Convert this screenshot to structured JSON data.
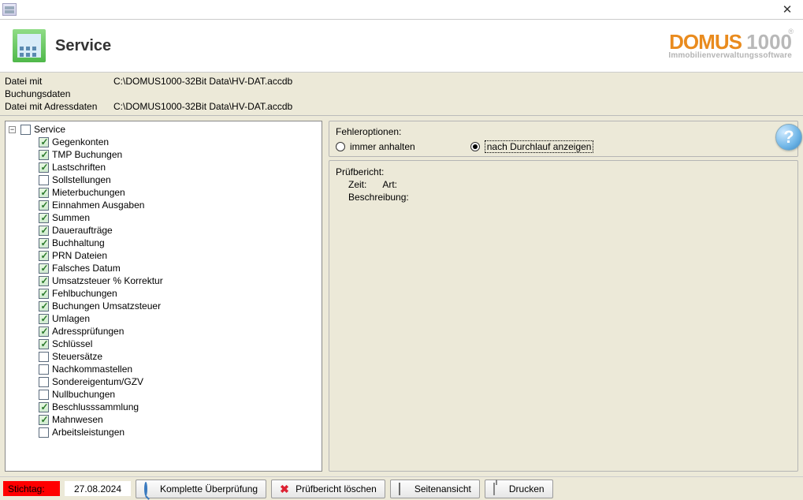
{
  "header": {
    "title": "Service"
  },
  "brand": {
    "main": "DOMUS ",
    "numbers": "1000",
    "reg": "®",
    "sub": "Immobilienverwaltungssoftware"
  },
  "paths": {
    "label_booking": "Datei mit Buchungsdaten",
    "value_booking": "C:\\DOMUS1000-32Bit Data\\HV-DAT.accdb",
    "label_address": "Datei mit Adressdaten",
    "value_address": "C:\\DOMUS1000-32Bit Data\\HV-DAT.accdb"
  },
  "tree": {
    "root": {
      "label": "Service",
      "checked": false
    },
    "items": [
      {
        "label": "Gegenkonten",
        "checked": true
      },
      {
        "label": "TMP Buchungen",
        "checked": true
      },
      {
        "label": "Lastschriften",
        "checked": true
      },
      {
        "label": "Sollstellungen",
        "checked": false
      },
      {
        "label": "Mieterbuchungen",
        "checked": true
      },
      {
        "label": "Einnahmen Ausgaben",
        "checked": true
      },
      {
        "label": "Summen",
        "checked": true
      },
      {
        "label": "Daueraufträge",
        "checked": true
      },
      {
        "label": "Buchhaltung",
        "checked": true
      },
      {
        "label": "PRN Dateien",
        "checked": true
      },
      {
        "label": "Falsches Datum",
        "checked": true
      },
      {
        "label": "Umsatzsteuer % Korrektur",
        "checked": true
      },
      {
        "label": "Fehlbuchungen",
        "checked": true
      },
      {
        "label": "Buchungen Umsatzsteuer",
        "checked": true
      },
      {
        "label": "Umlagen",
        "checked": true
      },
      {
        "label": "Adressprüfungen",
        "checked": true
      },
      {
        "label": "Schlüssel",
        "checked": true
      },
      {
        "label": "Steuersätze",
        "checked": false
      },
      {
        "label": "Nachkommastellen",
        "checked": false
      },
      {
        "label": "Sondereigentum/GZV",
        "checked": false
      },
      {
        "label": "Nullbuchungen",
        "checked": false
      },
      {
        "label": "Beschlusssammlung",
        "checked": true
      },
      {
        "label": "Mahnwesen",
        "checked": true
      },
      {
        "label": "Arbeitsleistungen",
        "checked": false
      }
    ]
  },
  "error_opts": {
    "legend": "Fehleroptionen:",
    "opt1": "immer anhalten",
    "opt2": "nach Durchlauf anzeigen",
    "selected": 2
  },
  "help_icon_text": "?",
  "report": {
    "legend": "Prüfbericht:",
    "time_lbl": "Zeit:",
    "time_val": "",
    "art_lbl": "Art:",
    "art_val": "",
    "desc_lbl": "Beschreibung:",
    "desc_val": ""
  },
  "footer": {
    "stichtag_lbl": "Stichtag:",
    "stichtag_val": "27.08.2024",
    "btn_full": "Komplette Überprüfung",
    "btn_delete": "Prüfbericht löschen",
    "btn_preview": "Seitenansicht",
    "btn_print": "Drucken"
  },
  "close_glyph": "✕",
  "expander_glyph": "−"
}
